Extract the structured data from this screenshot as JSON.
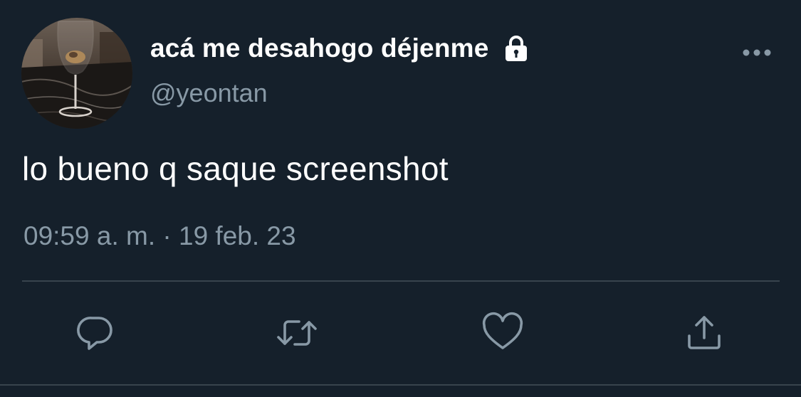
{
  "tweet": {
    "display_name": "acá me desahogo déjenme",
    "handle": "@yeontan",
    "text": "lo bueno q saque screenshot",
    "time": "09:59 a. m.",
    "separator": " · ",
    "date": "19 feb. 23",
    "protected": true
  },
  "icons": {
    "lock": "lock-icon",
    "more": "more-horizontal-icon",
    "reply": "reply-icon",
    "retweet": "retweet-icon",
    "like": "heart-icon",
    "share": "share-icon"
  },
  "colors": {
    "background": "#15202b",
    "text_primary": "#ffffff",
    "text_secondary": "#8899a6",
    "divider": "#38444d"
  }
}
